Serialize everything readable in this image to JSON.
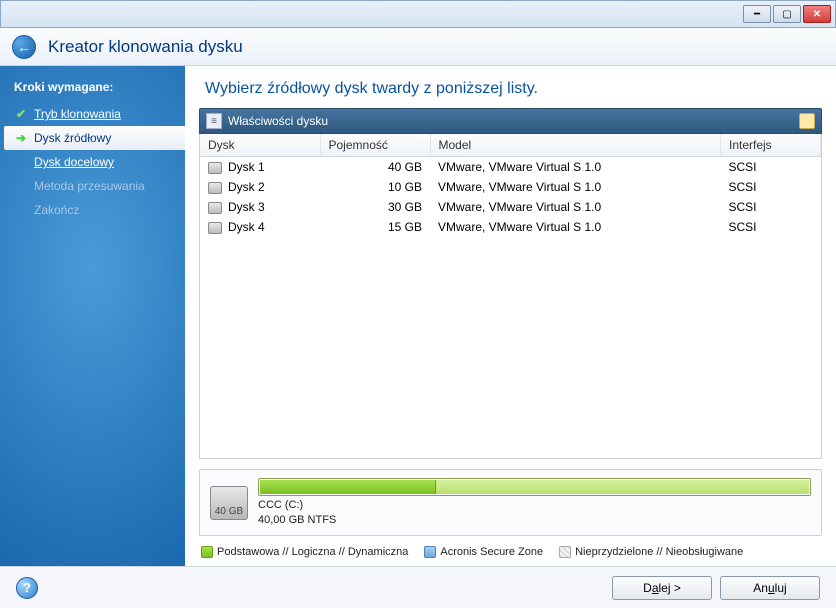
{
  "window": {
    "title": "Kreator klonowania dysku"
  },
  "sidebar": {
    "title": "Kroki wymagane:",
    "steps": [
      {
        "label": "Tryb klonowania",
        "state": "done"
      },
      {
        "label": "Dysk źródłowy",
        "state": "current"
      },
      {
        "label": "Dysk docelowy",
        "state": "pending"
      },
      {
        "label": "Metoda przesuwania",
        "state": "disabled"
      },
      {
        "label": "Zakończ",
        "state": "disabled"
      }
    ]
  },
  "content": {
    "heading": "Wybierz źródłowy dysk twardy z poniższej listy.",
    "panel_header": "Właściwości dysku",
    "columns": {
      "disk": "Dysk",
      "capacity": "Pojemność",
      "model": "Model",
      "interface": "Interfejs"
    },
    "rows": [
      {
        "disk": "Dysk 1",
        "capacity": "40 GB",
        "model": "VMware, VMware Virtual S 1.0",
        "interface": "SCSI"
      },
      {
        "disk": "Dysk 2",
        "capacity": "10 GB",
        "model": "VMware, VMware Virtual S 1.0",
        "interface": "SCSI"
      },
      {
        "disk": "Dysk 3",
        "capacity": "30 GB",
        "model": "VMware, VMware Virtual S 1.0",
        "interface": "SCSI"
      },
      {
        "disk": "Dysk 4",
        "capacity": "15 GB",
        "model": "VMware, VMware Virtual S 1.0",
        "interface": "SCSI"
      }
    ],
    "disk_preview": {
      "total_label": "40 GB",
      "part_label": "CCC (C:)",
      "part_detail": "40,00 GB  NTFS",
      "used_pct": 32
    },
    "legend": {
      "basic": "Podstawowa // Logiczna // Dynamiczna",
      "asz": "Acronis Secure Zone",
      "unalloc": "Nieprzydzielone // Nieobsługiwane"
    }
  },
  "footer": {
    "next_prefix": "D",
    "next_accel": "a",
    "next_suffix": "lej >",
    "cancel_prefix": "An",
    "cancel_accel": "u",
    "cancel_suffix": "luj"
  }
}
